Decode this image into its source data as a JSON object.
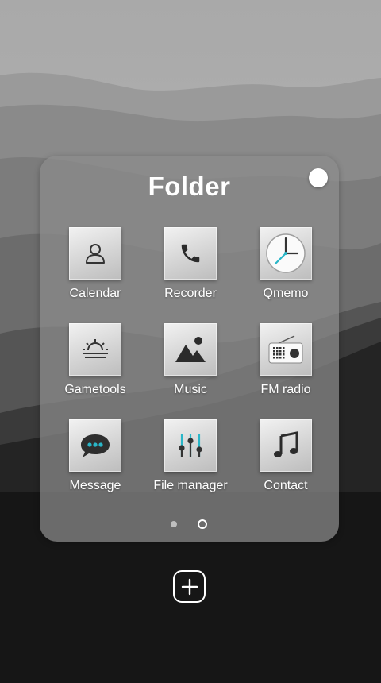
{
  "folder": {
    "title": "Folder",
    "apps": [
      {
        "label": "Calendar",
        "icon": "person-icon"
      },
      {
        "label": "Recorder",
        "icon": "phone-icon"
      },
      {
        "label": "Qmemo",
        "icon": "clock-icon"
      },
      {
        "label": "Gametools",
        "icon": "sunrise-icon"
      },
      {
        "label": "Music",
        "icon": "landscape-image-icon"
      },
      {
        "label": "FM radio",
        "icon": "radio-icon"
      },
      {
        "label": "Message",
        "icon": "speech-bubble-icon"
      },
      {
        "label": "File manager",
        "icon": "equalizer-sliders-icon"
      },
      {
        "label": "Contact",
        "icon": "music-note-icon"
      }
    ],
    "pages": {
      "count": 2,
      "active": 2
    }
  },
  "add_button": {
    "icon": "plus-icon"
  },
  "colors": {
    "accent": "#29b6c8",
    "folder_bg": "#8c8c8c"
  }
}
